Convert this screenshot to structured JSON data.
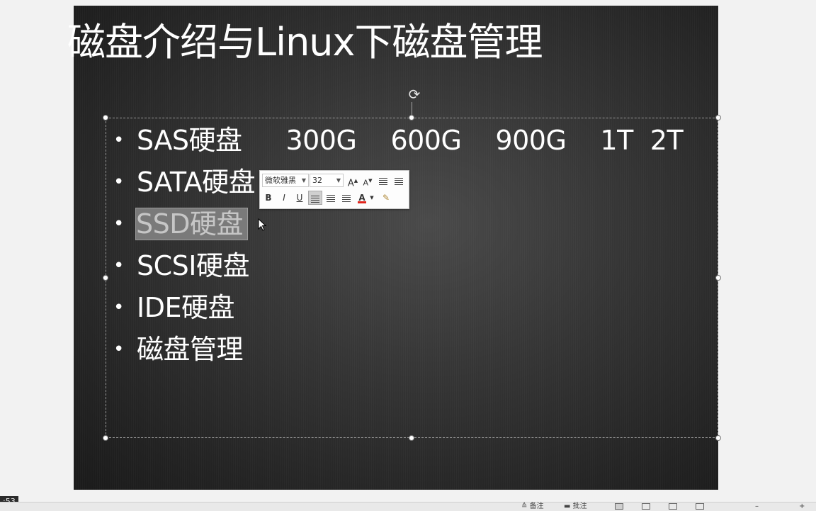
{
  "slide": {
    "title": "磁盘介绍与Linux下磁盘管理",
    "bullets": [
      {
        "label": "SAS硬盘",
        "values": [
          "300G",
          "600G",
          "900G",
          "1T",
          "2T"
        ]
      },
      {
        "label": "SATA硬盘"
      },
      {
        "label": "SSD硬盘"
      },
      {
        "label": "SCSI硬盘"
      },
      {
        "label": "IDE硬盘"
      },
      {
        "label": "磁盘管理"
      }
    ]
  },
  "mini_toolbar": {
    "font_name": "微软雅黑",
    "font_size": "32",
    "bold": "B",
    "italic": "I",
    "underline": "U",
    "font_color_glyph": "A",
    "grow_font": "A",
    "shrink_font": "A"
  },
  "video": {
    "time": ":53"
  },
  "statusbar": {
    "notes_label": "备注",
    "comments_label": "批注"
  },
  "colors": {
    "font_color_accent": "#e0261d",
    "slide_bg": "#2e2e2e"
  }
}
